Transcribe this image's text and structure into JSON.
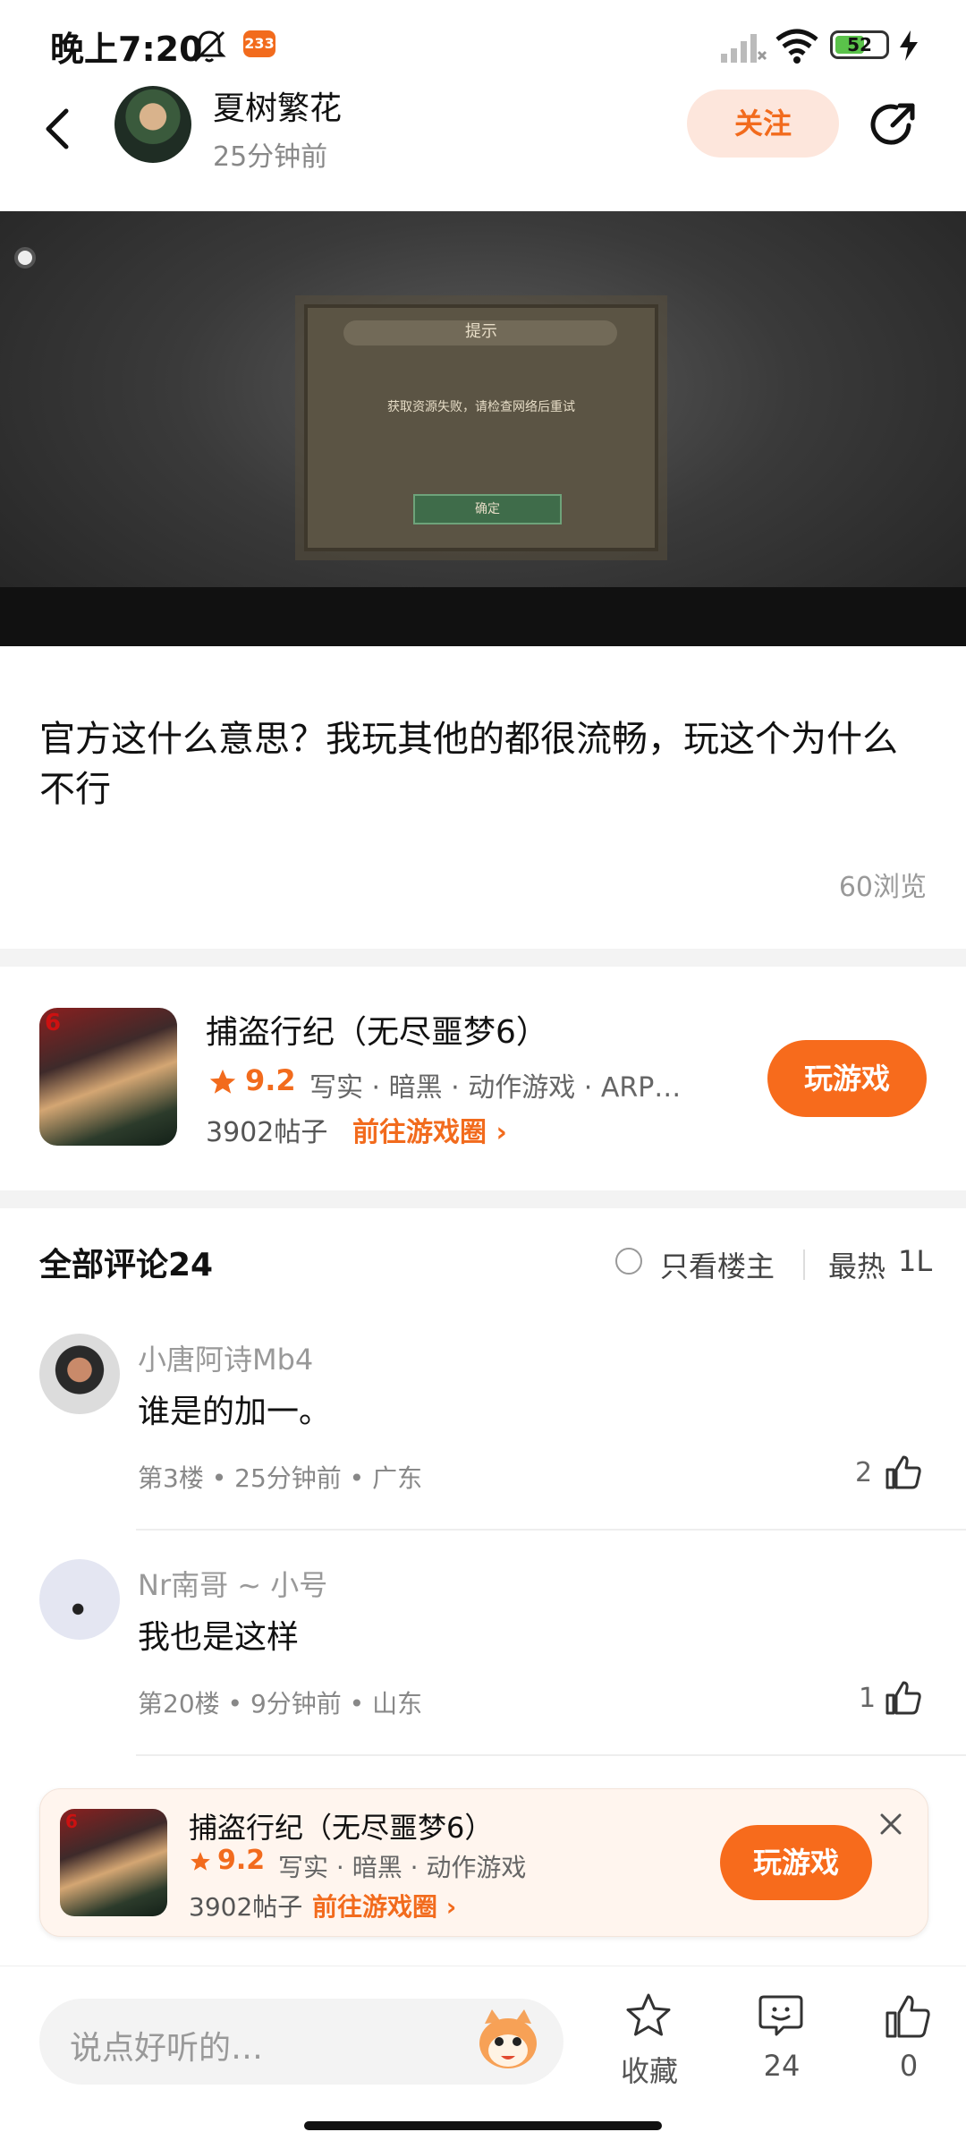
{
  "status_bar": {
    "time": "晚上7:20",
    "notification_badge": "233",
    "battery": "52"
  },
  "header": {
    "author_name": "夏树繁花",
    "post_time": "25分钟前",
    "follow_label": "关注"
  },
  "screenshot": {
    "dialog_title": "提示",
    "dialog_message": "获取资源失败，请检查网络后重试",
    "dialog_ok": "确定"
  },
  "post": {
    "text": "官方这什么意思？我玩其他的都很流畅，玩这个为什么不行",
    "views": "60浏览"
  },
  "game_card": {
    "title": "捕盗行纪（无尽噩梦6）",
    "rating": "9.2",
    "tags": "写实 · 暗黑 · 动作游戏 · ARP…",
    "posts": "3902帖子",
    "goto": "前往游戏圈",
    "play_label": "玩游戏",
    "icon_badge": "6"
  },
  "comments_header": {
    "title": "全部评论24",
    "only_op": "只看楼主",
    "sort": "最热",
    "sort2": "1L"
  },
  "comments": [
    {
      "user": "小唐阿诗Mb4",
      "text": "谁是的加一。",
      "meta": "第3楼 • 25分钟前 • 广东",
      "likes": "2"
    },
    {
      "user": "Nr南哥 ~ 小号",
      "text": "我也是这样",
      "meta": "第20楼 • 9分钟前 • 山东",
      "likes": "1"
    }
  ],
  "floating_banner": {
    "title": "捕盗行纪（无尽噩梦6）",
    "rating": "9.2",
    "tags": "写实 · 暗黑 · 动作游戏",
    "posts": "3902帖子",
    "goto": "前往游戏圈",
    "play_label": "玩游戏"
  },
  "bottom_bar": {
    "input_placeholder": "说点好听的…",
    "favorite_label": "收藏",
    "comment_count": "24",
    "like_count": "0"
  },
  "colors": {
    "accent": "#f76b1c",
    "follow_bg": "#fde6dc",
    "banner_bg": "#fff5ee"
  }
}
